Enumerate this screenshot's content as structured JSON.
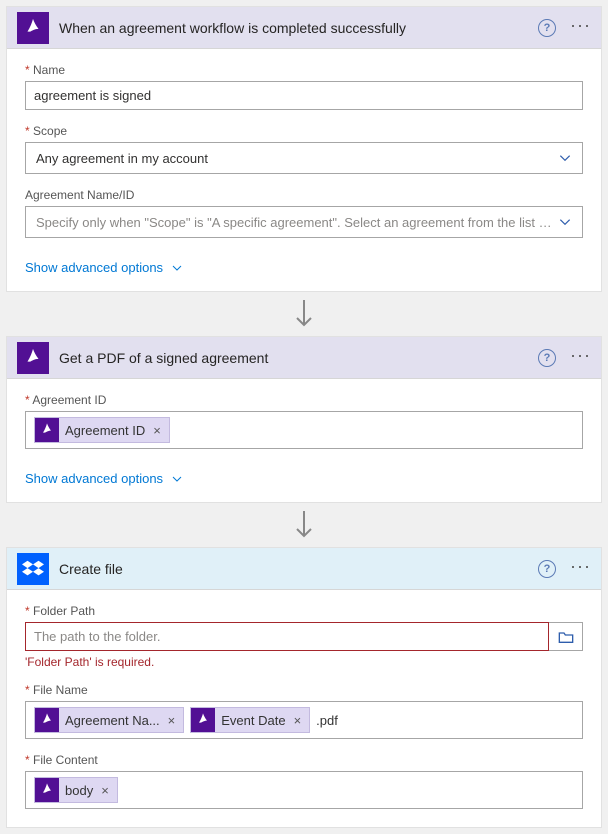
{
  "steps": [
    {
      "title": "When an agreement workflow is completed successfully",
      "advanced": "Show advanced options",
      "fields": {
        "name_label": "Name",
        "name_value": "agreement is signed",
        "scope_label": "Scope",
        "scope_value": "Any agreement in my account",
        "agid_label": "Agreement Name/ID",
        "agid_placeholder": "Specify only when \"Scope\" is \"A specific agreement\". Select an agreement from the list or enter th"
      }
    },
    {
      "title": "Get a PDF of a signed agreement",
      "advanced": "Show advanced options",
      "fields": {
        "agid_label": "Agreement ID",
        "token_agid": "Agreement ID"
      }
    },
    {
      "title": "Create file",
      "fields": {
        "folder_label": "Folder Path",
        "folder_placeholder": "The path to the folder.",
        "folder_error": "'Folder Path' is required.",
        "filename_label": "File Name",
        "token_agname": "Agreement Na...",
        "token_evdate": "Event Date",
        "suffix": ".pdf",
        "content_label": "File Content",
        "token_body": "body"
      }
    }
  ]
}
